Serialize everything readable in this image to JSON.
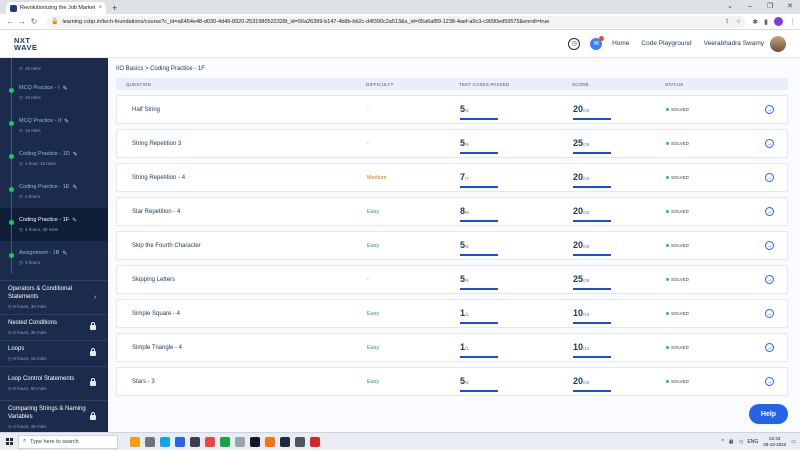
{
  "browser": {
    "tab_title": "Revolutionizing the Job Market |",
    "url": "learning.ccbp.in/tech-foundations/course?c_id=a6454e48-d030-4d49-8920-2531980522328t_id=56a26399-b147-4b8b-bb2c-d4f390c2a513&s_id=05a6af89-1238-4aef-a9c3-c9090ed59575&enroll=true",
    "new_tab": "+",
    "close": "×"
  },
  "header": {
    "logo_line1": "NXT",
    "logo_line2": "WAVE",
    "nav": [
      "Home",
      "Code Playground"
    ],
    "user_name": "Veerabhadra Swamy",
    "notification_count": "1"
  },
  "sidebar": {
    "top_meta": "15 mins",
    "items": [
      {
        "name": "MCQ Practice - I",
        "meta": "10 mins",
        "active": false
      },
      {
        "name": "MCQ Practice - II",
        "meta": "16 mins",
        "active": false
      },
      {
        "name": "Coding Practice - 1D",
        "meta": "1 hour, 15 mins",
        "active": false
      },
      {
        "name": "Coding Practice - 1E",
        "meta": "2 hours",
        "active": false
      },
      {
        "name": "Coding Practice - 1F",
        "meta": "2 hours, 30 mins",
        "active": true
      },
      {
        "name": "Assignment - 1B",
        "meta": "3 hours",
        "active": false
      }
    ],
    "sections": [
      {
        "title": "Operators & Conditional Statements",
        "meta": "8 hours, 30 mins",
        "locked": false
      },
      {
        "title": "Nested Conditions",
        "meta": "5 hours, 35 mins",
        "locked": true
      },
      {
        "title": "Loops",
        "meta": "8 hours, 15 mins",
        "locked": true
      },
      {
        "title": "Loop Control Statements",
        "meta": "8 hours, 50 mins",
        "locked": true
      },
      {
        "title": "Comparing Strings & Naming Variables",
        "meta": "4 hours, 45 mins",
        "locked": true
      }
    ]
  },
  "content": {
    "breadcrumb": "I/O Basics > Coding Practice - 1F",
    "columns": [
      "QUESTION",
      "DIFFICULTY",
      "TEST CASES PASSED",
      "SCORE",
      "STATUS"
    ],
    "rows": [
      {
        "q": "Half String",
        "diff": "-",
        "tc": "5",
        "tc_total": "/5",
        "score": "20",
        "score_total": "/20",
        "status": "SOLVED"
      },
      {
        "q": "String Repetition 3",
        "diff": "-",
        "tc": "5",
        "tc_total": "/5",
        "score": "25",
        "score_total": "/25",
        "status": "SOLVED"
      },
      {
        "q": "String Repetition - 4",
        "diff": "Medium",
        "tc": "7",
        "tc_total": "/7",
        "score": "20",
        "score_total": "/20",
        "status": "SOLVED"
      },
      {
        "q": "Star Repetition - 4",
        "diff": "Easy",
        "tc": "8",
        "tc_total": "/8",
        "score": "20",
        "score_total": "/20",
        "status": "SOLVED"
      },
      {
        "q": "Skip the Fourth Character",
        "diff": "Easy",
        "tc": "5",
        "tc_total": "/5",
        "score": "20",
        "score_total": "/20",
        "status": "SOLVED"
      },
      {
        "q": "Skipping Letters",
        "diff": "-",
        "tc": "5",
        "tc_total": "/5",
        "score": "25",
        "score_total": "/25",
        "status": "SOLVED"
      },
      {
        "q": "Simple Square - 4",
        "diff": "Easy",
        "tc": "1",
        "tc_total": "/1",
        "score": "10",
        "score_total": "/10",
        "status": "SOLVED"
      },
      {
        "q": "Simple Triangle - 4",
        "diff": "Easy",
        "tc": "1",
        "tc_total": "/1",
        "score": "10",
        "score_total": "/10",
        "status": "SOLVED"
      },
      {
        "q": "Stars - 3",
        "diff": "Easy",
        "tc": "5",
        "tc_total": "/5",
        "score": "20",
        "score_total": "/20",
        "status": "SOLVED"
      }
    ],
    "help": "Help"
  },
  "taskbar": {
    "search_placeholder": "Type here to search",
    "lang": "ENG",
    "time": "22:43",
    "date": "28-12-2022"
  },
  "colors": {
    "sidebar_bg": "#1b2b4b",
    "accent": "#2563eb",
    "easy": "#22a06b",
    "medium": "#d97706",
    "solved_dot": "#22c55e"
  }
}
